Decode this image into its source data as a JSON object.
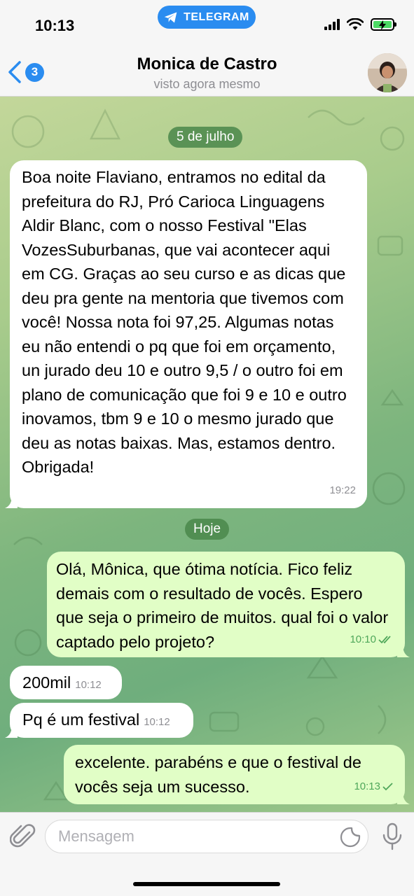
{
  "status_bar": {
    "time": "10:13",
    "app_pill": "TELEGRAM"
  },
  "header": {
    "back_count": "3",
    "contact_name": "Monica de Castro",
    "last_seen": "visto agora mesmo"
  },
  "messages": {
    "date1": "5 de julho",
    "m1": {
      "text": "Boa noite Flaviano, entramos no edital da prefeitura do RJ, Pró Carioca Linguagens Aldir Blanc, com o nosso Festival \"Elas VozesSuburbanas, que vai acontecer aqui em CG. Graças ao seu curso e as dicas que deu pra gente na mentoria que tivemos com você! Nossa nota foi 97,25. Algumas notas eu não entendi o pq que foi em orçamento, un jurado deu 10 e outro 9,5 / o outro foi em plano de comunicação que foi 9 e 10 e outro inovamos, tbm 9 e 10 o mesmo jurado que deu as notas baixas. Mas, estamos dentro. Obrigada!",
      "time": "19:22"
    },
    "date2": "Hoje",
    "m2": {
      "text": "Olá, Mônica, que ótima notícia. Fico feliz demais com o resultado de vocês. Espero que seja o primeiro de muitos. qual foi o valor captado pelo projeto?",
      "time": "10:10"
    },
    "m3": {
      "text": "200mil",
      "time": "10:12"
    },
    "m4": {
      "text": "Pq é um festival",
      "time": "10:12"
    },
    "m5": {
      "text": "excelente. parabéns e que o festival de vocês seja um sucesso.",
      "time": "10:13"
    }
  },
  "composer": {
    "placeholder": "Mensagem"
  },
  "colors": {
    "accent": "#2a8cf0",
    "incoming_bubble": "#ffffff",
    "outgoing_bubble": "#e1fec6",
    "date_pill": "#4a874a",
    "outgoing_meta": "#4fa75a"
  },
  "icons": [
    "telegram-icon",
    "signal-icon",
    "wifi-icon",
    "battery-icon",
    "back-chevron-icon",
    "paperclip-icon",
    "sticker-icon",
    "microphone-icon",
    "double-check-icon",
    "single-check-icon"
  ]
}
